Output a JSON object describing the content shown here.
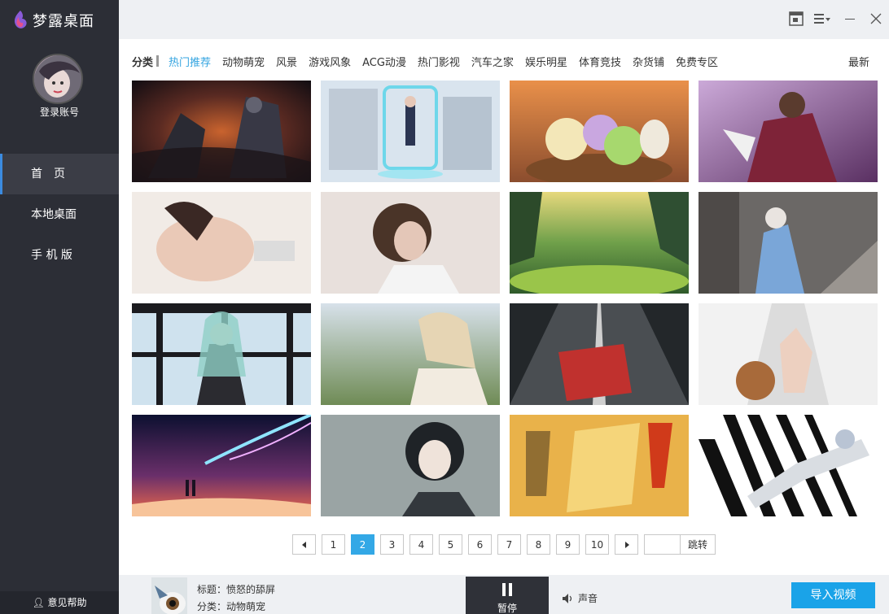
{
  "app": {
    "title": "梦露桌面"
  },
  "sidebar": {
    "login": "登录账号",
    "items": [
      {
        "label": "首　页"
      },
      {
        "label": "本地桌面"
      },
      {
        "label": "手 机 版"
      }
    ],
    "help": "意见帮助"
  },
  "categories": {
    "label": "分类",
    "items": [
      "热门推荐",
      "动物萌宠",
      "风景",
      "游戏风象",
      "ACG动漫",
      "热门影视",
      "汽车之家",
      "娱乐明星",
      "体育竞技",
      "杂货铺",
      "免费专区"
    ],
    "active": "热门推荐",
    "latest": "最新"
  },
  "pagination": {
    "pages": [
      "1",
      "2",
      "3",
      "4",
      "5",
      "6",
      "7",
      "8",
      "9",
      "10"
    ],
    "current": "2",
    "jump": "跳转"
  },
  "player": {
    "title_label": "标题：愤怒的舔屏",
    "category_label": "分类：动物萌宠",
    "pause": "暂停",
    "sound": "声音",
    "import": "导入视频"
  },
  "colors": {
    "accent": "#33a4e0",
    "sidebar": "#2c2e36",
    "import": "#1aa3e8"
  }
}
